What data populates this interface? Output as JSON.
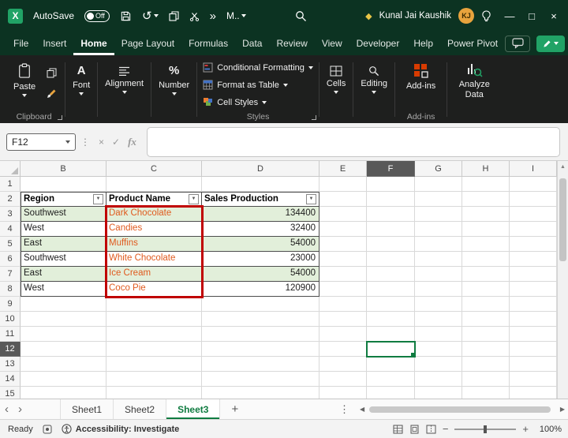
{
  "colors": {
    "titlebar": "#0C3322",
    "ribbon": "#1E1F1E",
    "accent": "#107C41",
    "accent_bright": "#21A366",
    "band": "#E2EFDA",
    "orange": "#E05A1E",
    "annot": "#C00000",
    "avatar": "#E8A33D",
    "addin": "#D83B01"
  },
  "icons": {
    "excel": "X",
    "filter": "▼",
    "up": "▲",
    "left": "◀",
    "right": "▶",
    "nav_left": "‹",
    "nav_right": "›",
    "dots": "⋮",
    "overflow": "»",
    "copilot": "◆",
    "plus": "+",
    "minus": "−",
    "close": "×",
    "minimize": "—",
    "maximize": "□",
    "check": "✓",
    "cancel": "×",
    "undo": "↺",
    "font": "A",
    "number": "%"
  },
  "titlebar": {
    "autosave_label": "AutoSave",
    "autosave_state": "Off",
    "document_title": "M..",
    "user_name": "Kunal Jai Kaushik",
    "user_initials": "KJ"
  },
  "menubar": {
    "tabs": [
      "File",
      "Insert",
      "Home",
      "Page Layout",
      "Formulas",
      "Data",
      "Review",
      "View",
      "Developer",
      "Help",
      "Power Pivot"
    ],
    "active_tab": "Home"
  },
  "ribbon": {
    "paste_label": "Paste",
    "clipboard_group_label": "Clipboard",
    "font_label": "Font",
    "alignment_label": "Alignment",
    "number_label": "Number",
    "conditional_formatting_label": "Conditional Formatting",
    "format_as_table_label": "Format as Table",
    "cell_styles_label": "Cell Styles",
    "styles_group_label": "Styles",
    "cells_label": "Cells",
    "editing_label": "Editing",
    "addins_label": "Add-ins",
    "addins_group_label": "Add-ins",
    "analyze_data_label": "Analyze Data"
  },
  "formula_bar": {
    "name_box": "F12",
    "fx_label": "fx",
    "formula_value": ""
  },
  "grid": {
    "columns": [
      "B",
      "C",
      "D",
      "E",
      "F",
      "G",
      "H",
      "I"
    ],
    "rows": [
      "1",
      "2",
      "3",
      "4",
      "5",
      "6",
      "7",
      "8",
      "9",
      "10",
      "11",
      "12",
      "13",
      "14",
      "15"
    ],
    "selected_cell": "F12",
    "selected_column": "F",
    "selected_row": "12",
    "table": {
      "range": "B2:D8",
      "headers": [
        "Region",
        "Product Name",
        "Sales Production"
      ],
      "rows": [
        [
          "Southwest",
          "Dark Chocolate",
          "134400"
        ],
        [
          "West",
          "Candies",
          "32400"
        ],
        [
          "East",
          "Muffins",
          "54000"
        ],
        [
          "Southwest",
          "White Chocolate",
          "23000"
        ],
        [
          "East",
          "Ice Cream",
          "54000"
        ],
        [
          "West",
          "Coco Pie",
          "120900"
        ]
      ],
      "highlighted_range": "C3:C8"
    }
  },
  "sheetbar": {
    "tabs": [
      "Sheet1",
      "Sheet2",
      "Sheet3"
    ],
    "active_tab": "Sheet3"
  },
  "statusbar": {
    "ready_label": "Ready",
    "accessibility_label": "Accessibility: Investigate",
    "zoom_level": "100%"
  }
}
